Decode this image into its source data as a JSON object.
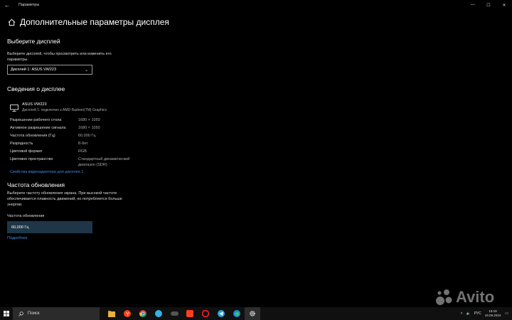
{
  "window": {
    "title": "Параметры",
    "controls": {
      "minimize": "—",
      "maximize": "☐",
      "close": "✕"
    }
  },
  "page": {
    "title": "Дополнительные параметры дисплея"
  },
  "select_display": {
    "heading": "Выберите дисплей",
    "description_line1": "Выберите дисплей, чтобы просмотреть или изменить его",
    "description_line2": "параметры.",
    "selected": "Дисплей 1: ASUS VW223"
  },
  "display_info": {
    "heading": "Сведения о дисплее",
    "monitor_name": "ASUS VW223",
    "monitor_sub": "Дисплей 1: подключен к AMD Radeon(TM) Graphics",
    "rows": [
      {
        "label": "Разрешение рабочего стола",
        "value": "1680 × 1050"
      },
      {
        "label": "Активное разрешение сигнала",
        "value": "1680 × 1050"
      },
      {
        "label": "Частота обновления (Гц)",
        "value": "60,000 Гц"
      },
      {
        "label": "Разрядность",
        "value": "8-бит"
      },
      {
        "label": "Цветовой формат",
        "value": "RGB"
      },
      {
        "label": "Цветовое пространство",
        "value": "Стандартный динамический",
        "value2": "диапазон (SDR)"
      }
    ],
    "adapter_link": "Свойства видеоадаптера для дисплея 1"
  },
  "refresh": {
    "heading": "Частота обновления",
    "description_line1": "Выберите частоту обновления экрана. При высокой частоте",
    "description_line2": "обеспечивается плавность движений, но потребляется больше",
    "description_line3": "энергии.",
    "label": "Частота обновления",
    "value": "60,000 Гц",
    "more_link": "Подробнее"
  },
  "watermark": {
    "text": "Avito"
  },
  "taskbar": {
    "search_placeholder": "Поиск",
    "language": "РУС",
    "time": "19:19",
    "date": "19.09.2024"
  },
  "colors": {
    "accent_link": "#3f8ae0",
    "selected_box": "#1f3648"
  }
}
